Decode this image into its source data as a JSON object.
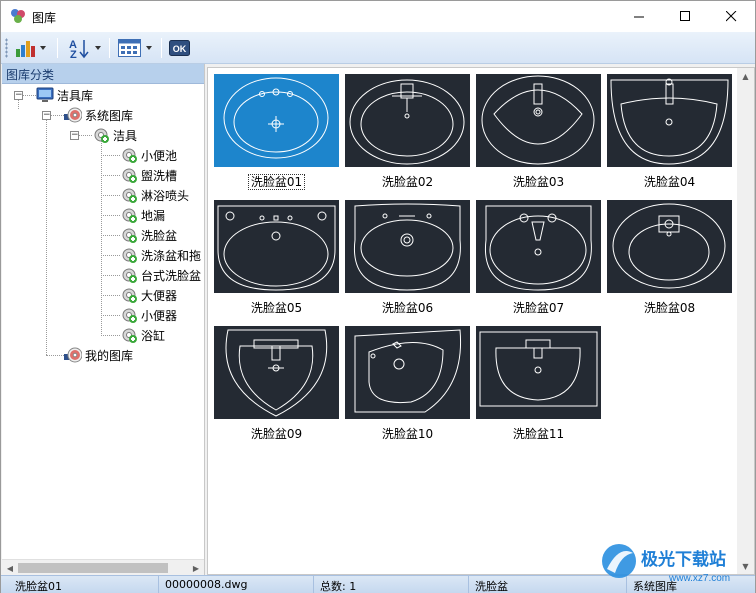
{
  "window": {
    "title": "图库",
    "controls": [
      "minimize",
      "maximize",
      "close"
    ]
  },
  "toolbar": {
    "buttons": [
      {
        "name": "chart-view",
        "icon": "bar-chart-icon",
        "has_dropdown": true
      },
      {
        "name": "sort",
        "icon": "sort-az-icon",
        "has_dropdown": true
      },
      {
        "name": "view-mode",
        "icon": "grid-view-icon",
        "has_dropdown": true
      },
      {
        "name": "ok",
        "icon": "ok-icon",
        "label": "OK"
      }
    ]
  },
  "left_pane": {
    "header": "图库分类",
    "tree": [
      {
        "label": "洁具库",
        "level": 0,
        "icon": "computer-icon"
      },
      {
        "label": "系统图库",
        "level": 1,
        "icon": "disc-icon"
      },
      {
        "label": "洁具",
        "level": 2,
        "icon": "gear-icon"
      },
      {
        "label": "小便池",
        "level": 3,
        "icon": "gear-icon"
      },
      {
        "label": "盥洗槽",
        "level": 3,
        "icon": "gear-icon"
      },
      {
        "label": "淋浴喷头",
        "level": 3,
        "icon": "gear-icon"
      },
      {
        "label": "地漏",
        "level": 3,
        "icon": "gear-icon"
      },
      {
        "label": "洗脸盆",
        "level": 3,
        "icon": "gear-icon"
      },
      {
        "label": "洗涤盆和拖",
        "level": 3,
        "icon": "gear-icon"
      },
      {
        "label": "台式洗脸盆",
        "level": 3,
        "icon": "gear-icon"
      },
      {
        "label": "大便器",
        "level": 3,
        "icon": "gear-icon"
      },
      {
        "label": "小便器",
        "level": 3,
        "icon": "gear-icon"
      },
      {
        "label": "浴缸",
        "level": 3,
        "icon": "gear-icon"
      },
      {
        "label": "我的图库",
        "level": 1,
        "icon": "disc-icon"
      }
    ]
  },
  "gallery": {
    "items": [
      {
        "label": "洗脸盆01",
        "selected": true
      },
      {
        "label": "洗脸盆02",
        "selected": false
      },
      {
        "label": "洗脸盆03",
        "selected": false
      },
      {
        "label": "洗脸盆04",
        "selected": false
      },
      {
        "label": "洗脸盆05",
        "selected": false
      },
      {
        "label": "洗脸盆06",
        "selected": false
      },
      {
        "label": "洗脸盆07",
        "selected": false
      },
      {
        "label": "洗脸盆08",
        "selected": false
      },
      {
        "label": "洗脸盆09",
        "selected": false
      },
      {
        "label": "洗脸盆10",
        "selected": false
      },
      {
        "label": "洗脸盆11",
        "selected": false
      }
    ]
  },
  "statusbar": {
    "name": "洗脸盆01",
    "file": "00000008.dwg",
    "total": "总数: 1",
    "category": "洗脸盆",
    "library": "系统图库"
  },
  "watermark": {
    "text": "极光下载站",
    "url": "www.xz7.com"
  },
  "colors": {
    "thumb_bg": "#242a33",
    "selected_bg": "#1d85cc",
    "toolbar_bg": "#d6e4f5",
    "header_bg": "#b7d0ec"
  }
}
